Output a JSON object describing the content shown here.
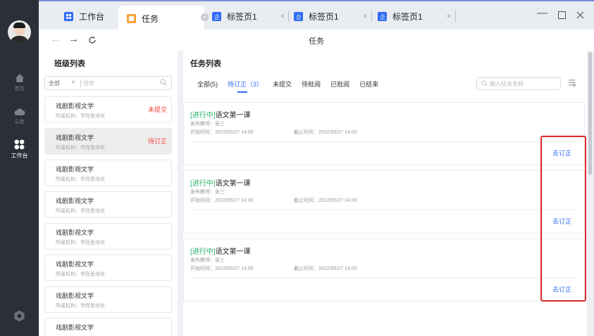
{
  "sidebar": {
    "items": [
      {
        "label": "首页",
        "icon": "home-icon"
      },
      {
        "label": "云盘",
        "icon": "cloud-icon"
      },
      {
        "label": "工作台",
        "icon": "workbench-icon"
      }
    ]
  },
  "tabs": [
    {
      "label": "工作台",
      "icon_color": "#2f6bf5"
    },
    {
      "label": "任务",
      "icon_color": "#f7a23b"
    },
    {
      "label": "标签页1",
      "icon_color": "#2f6bf5"
    },
    {
      "label": "标签页1",
      "icon_color": "#2f6bf5"
    },
    {
      "label": "标签页1",
      "icon_color": "#2f6bf5"
    }
  ],
  "nav": {
    "title": "任务"
  },
  "class_panel": {
    "title": "班级列表",
    "filter_value": "全部",
    "search_placeholder": "搜索",
    "items": [
      {
        "name": "戏剧影视文学",
        "org": "所属机构：学而思培优",
        "badge": "未提交"
      },
      {
        "name": "戏剧影视文学",
        "org": "所属机构：学而思培优",
        "badge": "待订正"
      },
      {
        "name": "戏剧影视文学",
        "org": "所属机构：学而思培优",
        "badge": ""
      },
      {
        "name": "戏剧影视文学",
        "org": "所属机构：学而思培优",
        "badge": ""
      },
      {
        "name": "戏剧影视文学",
        "org": "所属机构：学而思培优",
        "badge": ""
      },
      {
        "name": "戏剧影视文学",
        "org": "所属机构：学而思培优",
        "badge": ""
      },
      {
        "name": "戏剧影视文学",
        "org": "所属机构：学而思培优",
        "badge": ""
      },
      {
        "name": "戏剧影视文学",
        "org": "",
        "badge": ""
      }
    ]
  },
  "task_panel": {
    "title": "任务列表",
    "filters": [
      "全部(5)",
      "待订正（3）",
      "未提交",
      "待批阅",
      "已批阅",
      "已结束"
    ],
    "search_placeholder": "输入任务名称",
    "tasks": [
      {
        "status": "[进行中]",
        "title": "语文第一课",
        "teacher": "发布教师：张三",
        "start": "开始时间：2022/05/27 14:00",
        "end": "截止时间：2022/05/27 14:00",
        "action": "去订正"
      },
      {
        "status": "[进行中]",
        "title": "语文第一课",
        "teacher": "发布教师：张三",
        "start": "开始时间：2022/05/27 14:00",
        "end": "截止时间：2022/05/27 14:00",
        "action": "去订正"
      },
      {
        "status": "[进行中]",
        "title": "语文第一课",
        "teacher": "发布教师：张三",
        "start": "开始时间：2022/05/27 14:00",
        "end": "截止时间：2022/05/27 14:00",
        "action": "去订正"
      }
    ]
  }
}
